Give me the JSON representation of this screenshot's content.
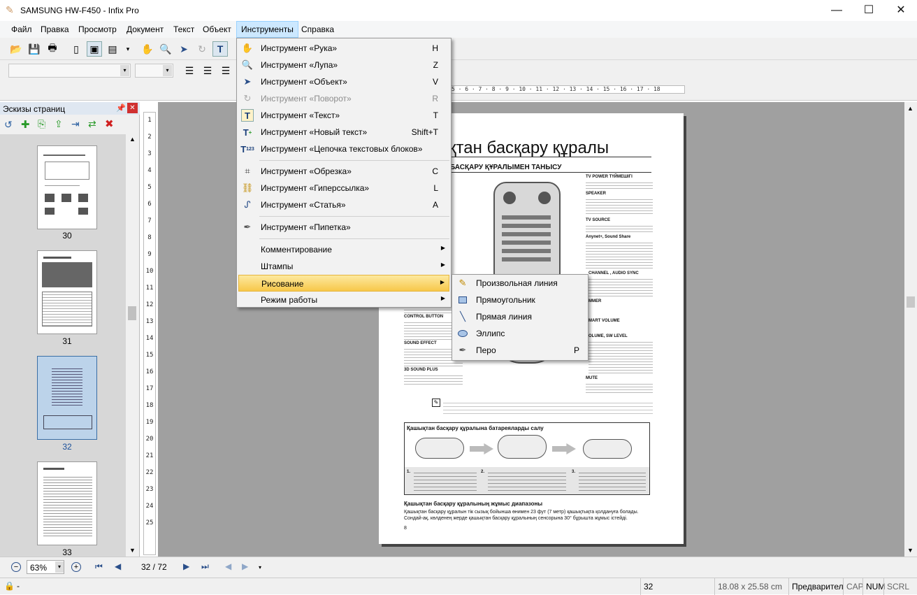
{
  "window": {
    "title": "SAMSUNG HW-F450 - Infix Pro",
    "minimize": "—",
    "maximize": "☐",
    "close": "✕"
  },
  "menubar": {
    "items": [
      "Файл",
      "Правка",
      "Просмотр",
      "Документ",
      "Текст",
      "Объект",
      "Инструменты",
      "Справка"
    ],
    "active": "Инструменты"
  },
  "toolbar": {
    "icons": [
      "open-icon",
      "save-icon",
      "print-icon",
      "page-single-icon",
      "page-fit-icon",
      "page-width-icon",
      "dropdown-icon",
      "hand-icon",
      "zoom-icon",
      "select-icon",
      "rotate-icon",
      "text-icon"
    ],
    "align": [
      "align-left-icon",
      "align-center-icon",
      "align-right-icon"
    ]
  },
  "ruler": {
    "horizontal": "5 · 6 · 7 · 8 · 9 · 10 · 11 · 12 · 13 · 14 · 15 · 16 · 17 · 18",
    "vertical": [
      "1",
      "2",
      "3",
      "4",
      "5",
      "6",
      "7",
      "8",
      "9",
      "10",
      "11",
      "12",
      "13",
      "14",
      "15",
      "16",
      "17",
      "18",
      "19",
      "20",
      "21",
      "22",
      "23",
      "24",
      "25"
    ]
  },
  "thumbnails": {
    "title": "Эскизы страниц",
    "pages": [
      {
        "num": "30",
        "selected": false
      },
      {
        "num": "31",
        "selected": false
      },
      {
        "num": "32",
        "selected": true
      },
      {
        "num": "33",
        "selected": false
      }
    ]
  },
  "tools_menu": {
    "items": [
      {
        "label": "Инструмент «Рука»",
        "shortcut": "H",
        "icon": "hand-icon",
        "disabled": false
      },
      {
        "label": "Инструмент «Лупа»",
        "shortcut": "Z",
        "icon": "magnifier-icon",
        "disabled": false
      },
      {
        "label": "Инструмент «Объект»",
        "shortcut": "V",
        "icon": "arrow-icon",
        "disabled": false
      },
      {
        "label": "Инструмент «Поворот»",
        "shortcut": "R",
        "icon": "rotate-icon",
        "disabled": true
      },
      {
        "label": "Инструмент «Текст»",
        "shortcut": "T",
        "icon": "text-tool-icon",
        "disabled": false
      },
      {
        "label": "Инструмент «Новый текст»",
        "shortcut": "Shift+T",
        "icon": "new-text-icon",
        "disabled": false
      },
      {
        "label": "Инструмент «Цепочка текстовых блоков»",
        "shortcut": "",
        "icon": "text-chain-icon",
        "disabled": false
      },
      {
        "label": "Инструмент «Обрезка»",
        "shortcut": "C",
        "icon": "crop-icon",
        "disabled": false
      },
      {
        "label": "Инструмент «Гиперссылка»",
        "shortcut": "L",
        "icon": "hyperlink-icon",
        "disabled": false
      },
      {
        "label": "Инструмент «Статья»",
        "shortcut": "A",
        "icon": "article-icon",
        "disabled": false
      },
      {
        "label": "Инструмент «Пипетка»",
        "shortcut": "",
        "icon": "eyedropper-icon",
        "disabled": false
      },
      {
        "label": "Комментирование",
        "submenu": true
      },
      {
        "label": "Штампы",
        "submenu": true
      },
      {
        "label": "Рисование",
        "submenu": true,
        "highlighted": true
      },
      {
        "label": "Режим работы",
        "submenu": true
      }
    ]
  },
  "draw_submenu": {
    "items": [
      {
        "label": "Произвольная линия",
        "shortcut": "",
        "icon": "pencil-icon"
      },
      {
        "label": "Прямоугольник",
        "shortcut": "",
        "icon": "rectangle-icon"
      },
      {
        "label": "Прямая линия",
        "shortcut": "",
        "icon": "line-icon"
      },
      {
        "label": "Эллипс",
        "shortcut": "",
        "icon": "ellipse-icon"
      },
      {
        "label": "Перо",
        "shortcut": "P",
        "icon": "pen-icon"
      }
    ]
  },
  "document": {
    "heading": "қтан басқару құралы",
    "subheading": "БАСҚАРУ ҚҰРАЛЫМЕН ТАНЫСУ",
    "labels_right": [
      "TV POWER ТҮЙМЕШІГІ",
      "SPEAKER",
      "TV SOURCE",
      "Anynet+, Sound Share",
      "CHANNEL , AUDIO SYNC",
      "MMER",
      "MART VOLUME",
      "OLUME, SW LEVEL",
      "MUTE"
    ],
    "labels_left": [
      "CONTROL BUTTON",
      "SOUND EFFECT",
      "3D SOUND PLUS"
    ],
    "battery_title": "Қашықтан басқару құралына батареяларды салу",
    "steps": [
      "1.",
      "2.",
      "3."
    ],
    "range_title": "Қашықтан басқару құралының жұмыс диапазоны",
    "range_text": "Қашықтан басқару құралын тік сызық бойынша өнимен 23 фут (7 метр) қашықтықта қолдануға болады. Сондай-ақ, көлденең жерде қашықтан басқару құралының сенсорына 30° бұрышта жұмыс істейді.",
    "page_number": "8"
  },
  "navigation": {
    "zoom": "63%",
    "page": "32 / 72"
  },
  "status": {
    "left": "-",
    "page": "32",
    "size": "18.08 x 25.58 cm",
    "mode": "Предварител",
    "caps": "CAP",
    "num": "NUM",
    "scrl": "SCRL"
  }
}
